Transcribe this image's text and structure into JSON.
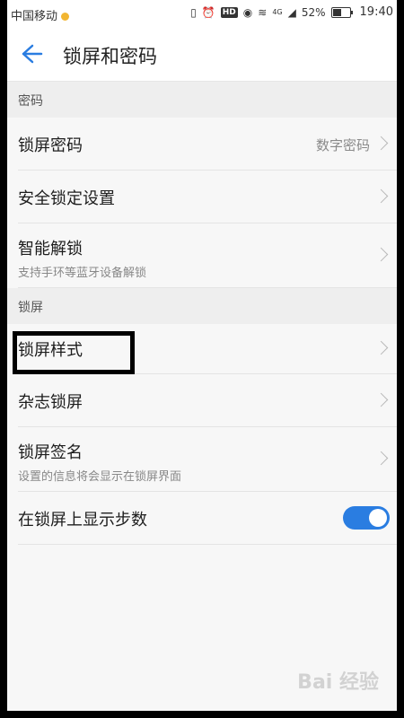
{
  "status_bar": {
    "carrier": "中国移动",
    "network": "4G",
    "battery": "52%",
    "time": "19:40",
    "battery_level": 0.52,
    "icons": [
      "vibrate-icon",
      "alarm-icon",
      "hd-icon",
      "eye-icon",
      "wifi-icon",
      "signal-icon",
      "battery-icon"
    ]
  },
  "header": {
    "title": "锁屏和密码",
    "back_icon": "back-arrow-icon"
  },
  "sections": [
    {
      "header": "密码",
      "rows": [
        {
          "label": "锁屏密码",
          "value": "数字密码"
        },
        {
          "label": "安全锁定设置"
        },
        {
          "label": "智能解锁",
          "sub": "支持手环等蓝牙设备解锁"
        }
      ]
    },
    {
      "header": "锁屏",
      "rows": [
        {
          "label": "锁屏样式"
        },
        {
          "label": "杂志锁屏"
        },
        {
          "label": "锁屏签名",
          "sub": "设置的信息将会显示在锁屏界面"
        },
        {
          "label": "在锁屏上显示步数",
          "toggle": true
        }
      ]
    }
  ],
  "watermark": "Bai 经验",
  "colors": {
    "accent": "#2a7de1",
    "background": "#f7f7f7",
    "section_bg": "#eeeeee"
  }
}
